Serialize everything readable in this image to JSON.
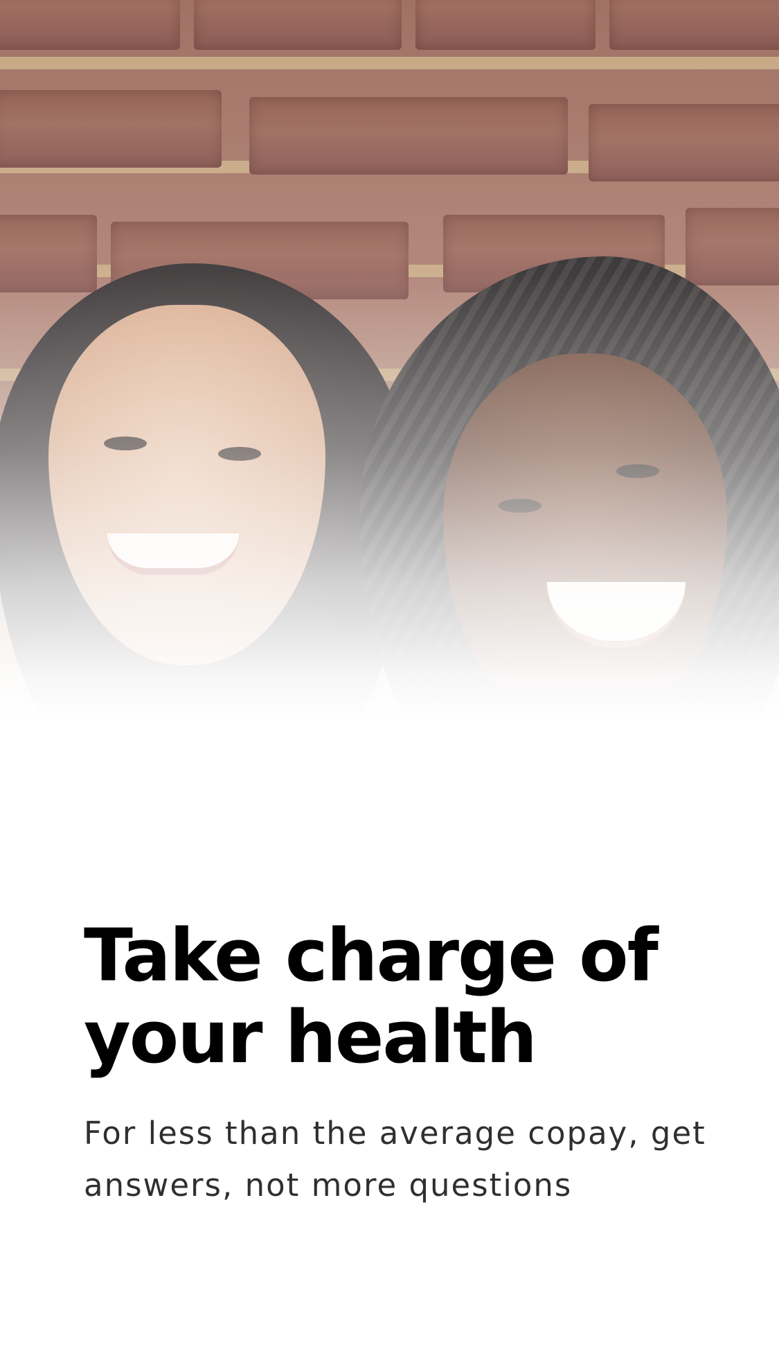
{
  "hero": {
    "image_alt": "Two smiling women in front of a brick wall"
  },
  "onboarding": {
    "headline_line1": "Take charge of",
    "headline_line2": "your health",
    "subtitle_line1": "For less than the average copay, get",
    "subtitle_line2": "answers, not more questions"
  },
  "colors": {
    "headline": "#000000",
    "subtitle": "#2f2f2f",
    "background": "#ffffff"
  }
}
